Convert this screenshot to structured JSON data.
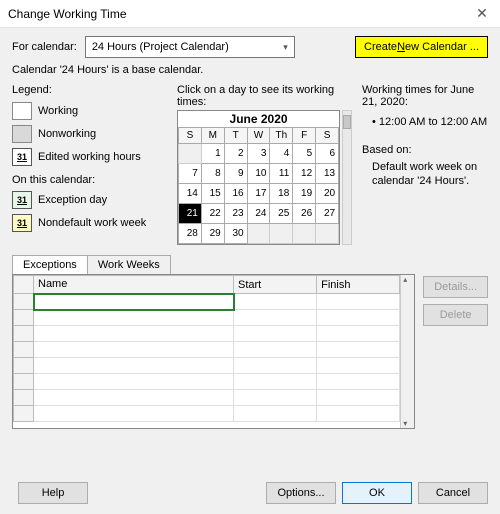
{
  "window": {
    "title": "Change Working Time",
    "close_glyph": "✕"
  },
  "header": {
    "for_label": "For calendar:",
    "combo_value": "24 Hours (Project Calendar)",
    "create_btn_pre": "Create ",
    "create_btn_u": "N",
    "create_btn_post": "ew Calendar ...",
    "subtext": "Calendar '24 Hours' is a base calendar."
  },
  "legend": {
    "title": "Legend:",
    "working": "Working",
    "nonworking": "Nonworking",
    "edited": "Edited working hours",
    "on_this": "On this calendar:",
    "exception": "Exception day",
    "nondefault": "Nondefault work week"
  },
  "calendar": {
    "hint": "Click on a day to see its working times:",
    "title": "June 2020",
    "dow": [
      "S",
      "M",
      "T",
      "W",
      "Th",
      "F",
      "S"
    ],
    "weeks": [
      [
        "",
        "1",
        "2",
        "3",
        "4",
        "5",
        "6"
      ],
      [
        "7",
        "8",
        "9",
        "10",
        "11",
        "12",
        "13"
      ],
      [
        "14",
        "15",
        "16",
        "17",
        "18",
        "19",
        "20"
      ],
      [
        "21",
        "22",
        "23",
        "24",
        "25",
        "26",
        "27"
      ],
      [
        "28",
        "29",
        "30",
        "",
        "",
        "",
        ""
      ]
    ],
    "selected": "21"
  },
  "info": {
    "wtitle": "Working times for June 21, 2020:",
    "bullet": "• 12:00 AM to 12:00 AM",
    "based": "Based on:",
    "basedtxt": "Default work week on calendar '24 Hours'."
  },
  "tabs": {
    "exceptions": "Exceptions",
    "workweeks": "Work Weeks"
  },
  "grid": {
    "name": "Name",
    "start": "Start",
    "finish": "Finish"
  },
  "sidebtns": {
    "details": "Details...",
    "delete": "Delete"
  },
  "footer": {
    "help": "Help",
    "options": "Options...",
    "ok": "OK",
    "cancel": "Cancel"
  }
}
